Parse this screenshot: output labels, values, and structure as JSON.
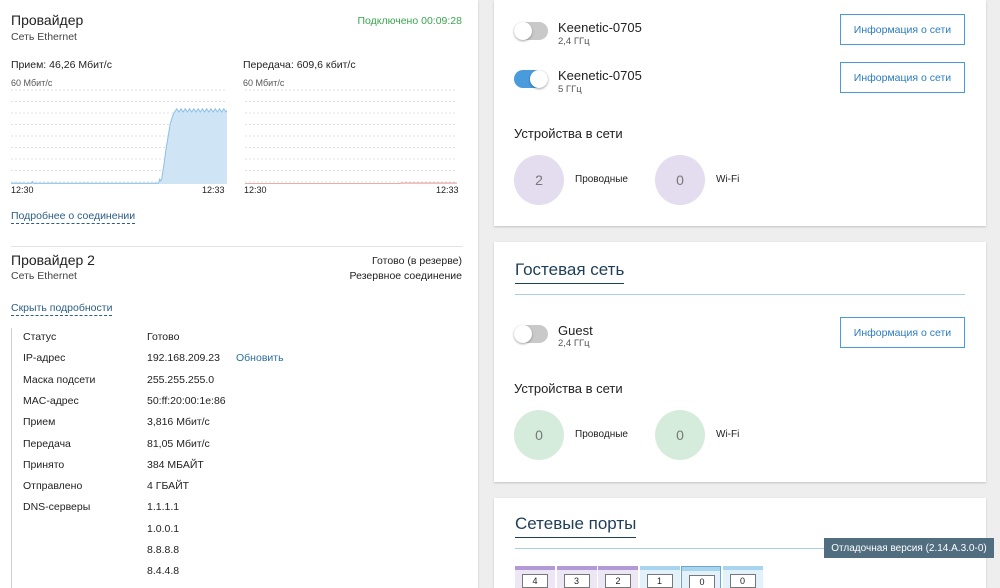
{
  "provider1": {
    "title": "Провайдер",
    "subtitle": "Сеть Ethernet",
    "status": "Подключено 00:09:28",
    "rx_label": "Прием: 46,26 Мбит/с",
    "tx_label": "Передача: 609,6 кбит/с",
    "rx_max": "60 Мбит/с",
    "tx_max": "60 Мбит/с",
    "rx_time_start": "12:30",
    "rx_time_end": "12:33",
    "tx_time_start": "12:30",
    "tx_time_end": "12:33",
    "details_link": "Подробнее о соединении"
  },
  "chart_data": [
    {
      "type": "area",
      "title": "Прием: 46,26 Мбит/с",
      "ylim": [
        0,
        60
      ],
      "ylabel": "60 Мбит/с",
      "x_ticks": [
        "12:30",
        "12:33"
      ],
      "grid": true,
      "color": "#4a9bdc",
      "series": [
        {
          "values": [
            0.5,
            0.5,
            0.5,
            0.6,
            0.5,
            0.5,
            0.6,
            0.5,
            0.5,
            0.5,
            0.5,
            0.6,
            0.5,
            0.5,
            0.5,
            0.5,
            0.5,
            0.5,
            0.5,
            0.5,
            1.5,
            0.5,
            0.5,
            0.5,
            0.5,
            0.5,
            0.5,
            0.5,
            0.5,
            0.5,
            0.5,
            0.5,
            0.5,
            0.5,
            0.5,
            0.5,
            0.5,
            0.6,
            0.5,
            0.5,
            0.5,
            0.5,
            0.5,
            0.5,
            0.5,
            0.5,
            0.5,
            0.5,
            0.5,
            0.5,
            0.5,
            0.5,
            0.5,
            0.5,
            0.5,
            0.5,
            0.5,
            0.5,
            0.5,
            0.5,
            0.5,
            0.5,
            0.5,
            0.5,
            0.5,
            0.5,
            0.5,
            0.5,
            0.5,
            0.5,
            0.5,
            0.6,
            0.5,
            0.5,
            0.5,
            0.5,
            0.5,
            0.5,
            0.5,
            0.5,
            0.5,
            0.5,
            0.5,
            0.5,
            0.5,
            0.5,
            0.5,
            0.5,
            0.5,
            0.5,
            0.5,
            0.5,
            0.5,
            0.5,
            0.5,
            0.5,
            0.5,
            0.5,
            0.5,
            0.5,
            0.5,
            0.5,
            0.5,
            0.5,
            0.5,
            0.5,
            0.5,
            0.5,
            0.5,
            0.5,
            0.5,
            0.5,
            0.5,
            0.5,
            0.5,
            0.5,
            0.5,
            0.5,
            0.5,
            0.5,
            0.5,
            0.5,
            0.5,
            0.5,
            0.5,
            0.5,
            0.5,
            0.5,
            0.5,
            0.5,
            0.5,
            0.5,
            0.5,
            0.5,
            0.5,
            0.5,
            0.5,
            0.5,
            0.5,
            3,
            2,
            3,
            8,
            12,
            17,
            22,
            26,
            30,
            34,
            38,
            40,
            42,
            44,
            45,
            46,
            47,
            46,
            45,
            46,
            47,
            46,
            45,
            46,
            47,
            46,
            45,
            46,
            47,
            46,
            45,
            46,
            47,
            46,
            45,
            46,
            47,
            46,
            45,
            46,
            47,
            46,
            45,
            46,
            47,
            46,
            45,
            46,
            47,
            46,
            45,
            46,
            47,
            46,
            45,
            46,
            47,
            46,
            45,
            46,
            47,
            46,
            45,
            46
          ]
        }
      ]
    },
    {
      "type": "area",
      "title": "Передача: 609,6 кбит/с",
      "ylim": [
        0,
        60
      ],
      "ylabel": "60 Мбит/с",
      "x_ticks": [
        "12:30",
        "12:33"
      ],
      "grid": true,
      "color": "#e8a0a0",
      "series": [
        {
          "values": [
            0.2,
            0.2,
            0.2,
            0.2,
            0.2,
            0.2,
            0.2,
            0.2,
            0.2,
            0.2,
            0.2,
            0.2,
            0.2,
            0.2,
            0.2,
            0.2,
            0.2,
            0.2,
            0.2,
            0.2,
            0.2,
            0.2,
            0.2,
            0.2,
            0.2,
            0.2,
            0.2,
            0.2,
            0.2,
            0.2,
            0.2,
            0.2,
            0.2,
            0.2,
            0.2,
            0.2,
            0.2,
            0.2,
            0.2,
            0.2,
            0.2,
            0.2,
            0.2,
            0.2,
            0.2,
            0.2,
            0.2,
            0.2,
            0.2,
            0.2,
            0.2,
            0.2,
            0.2,
            0.2,
            0.2,
            0.2,
            0.2,
            0.2,
            0.2,
            0.2,
            0.2,
            0.2,
            0.2,
            0.2,
            0.2,
            0.2,
            0.2,
            0.2,
            0.2,
            0.2,
            0.2,
            0.2,
            0.2,
            0.2,
            0.2,
            0.2,
            0.2,
            0.2,
            0.2,
            0.2,
            0.2,
            0.2,
            0.2,
            0.2,
            0.2,
            0.2,
            0.2,
            0.2,
            0.2,
            0.2,
            0.2,
            0.2,
            0.2,
            0.2,
            0.2,
            0.2,
            0.2,
            0.2,
            0.2,
            0.2,
            0.2,
            0.2,
            0.2,
            0.2,
            0.2,
            0.2,
            0.2,
            0.2,
            0.2,
            0.2,
            0.2,
            0.2,
            0.2,
            0.2,
            0.2,
            0.2,
            0.2,
            0.2,
            0.2,
            0.2,
            0.2,
            0.2,
            0.2,
            0.2,
            0.2,
            0.2,
            0.2,
            0.2,
            0.2,
            0.2,
            0.2,
            0.2,
            0.2,
            0.2,
            0.2,
            0.2,
            0.2,
            0.2,
            0.2,
            0.2,
            0.2,
            0.2,
            0.2,
            0.2,
            0.2,
            0.4,
            0.5,
            0.6,
            0.6,
            0.6,
            0.6,
            0.6,
            0.6,
            0.6,
            0.6,
            0.6,
            0.6,
            0.6,
            0.6,
            0.6,
            0.6,
            0.6,
            0.6,
            0.6,
            0.6,
            0.6,
            0.6,
            0.6,
            0.6,
            0.6,
            0.6,
            0.6,
            0.6,
            0.6,
            0.6,
            0.6,
            0.6,
            0.6,
            0.6,
            0.6,
            0.6,
            0.6,
            0.6,
            0.6,
            0.6,
            0.6,
            0.6,
            0.6,
            0.6,
            0.6,
            0.6,
            0.6,
            0.6,
            0.6,
            0.6,
            0.6,
            0.6,
            0.6,
            0.6,
            0.6
          ]
        }
      ]
    }
  ],
  "provider2": {
    "title": "Провайдер 2",
    "subtitle": "Сеть Ethernet",
    "status": "Готово (в резерве)",
    "status_sub": "Резервное соединение",
    "hide_link": "Скрыть подробности",
    "details": [
      {
        "label": "Статус",
        "value": "Готово"
      },
      {
        "label": "IP-адрес",
        "value": "192.168.209.23",
        "action": "Обновить"
      },
      {
        "label": "Маска подсети",
        "value": "255.255.255.0"
      },
      {
        "label": "MAC-адрес",
        "value": "50:ff:20:00:1e:86"
      },
      {
        "label": "Прием",
        "value": "3,816 Мбит/с"
      },
      {
        "label": "Передача",
        "value": "81,05 Мбит/с"
      },
      {
        "label": "Принято",
        "value": "384 МБАЙТ"
      },
      {
        "label": "Отправлено",
        "value": "4 ГБАЙТ"
      },
      {
        "label": "DNS-серверы",
        "value": "1.1.1.1"
      },
      {
        "label": "",
        "value": "1.0.0.1"
      },
      {
        "label": "",
        "value": "8.8.8.8"
      },
      {
        "label": "",
        "value": "8.4.4.8"
      }
    ]
  },
  "wifi": {
    "networks": [
      {
        "name": "Keenetic-0705",
        "band": "2,4 ГГц",
        "enabled": false,
        "button": "Информация о сети"
      },
      {
        "name": "Keenetic-0705",
        "band": "5 ГГц",
        "enabled": true,
        "button": "Информация о сети"
      }
    ],
    "devices_title": "Устройства в сети",
    "wired_count": "2",
    "wired_label": "Проводные",
    "wifi_count": "0",
    "wifi_label": "Wi-Fi"
  },
  "guest": {
    "title": "Гостевая сеть",
    "network": {
      "name": "Guest",
      "band": "2,4 ГГц",
      "enabled": false,
      "button": "Информация о сети"
    },
    "devices_title": "Устройства в сети",
    "wired_count": "0",
    "wired_label": "Проводные",
    "wifi_count": "0",
    "wifi_label": "Wi-Fi"
  },
  "ports": {
    "title": "Сетевые порты",
    "items": [
      {
        "num": "4",
        "color": "#b39ad6"
      },
      {
        "num": "3",
        "color": "#b39ad6"
      },
      {
        "num": "2",
        "color": "#b39ad6"
      },
      {
        "num": "1",
        "color": "#a8d4ef"
      },
      {
        "num": "0",
        "color": "#a8d4ef"
      },
      {
        "num": "0",
        "color": "#a8d4ef"
      }
    ]
  },
  "tooltip": "Отладочная версия (2.14.A.3.0-0)"
}
